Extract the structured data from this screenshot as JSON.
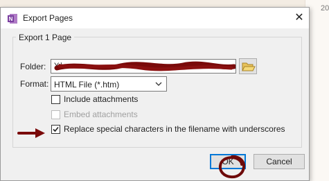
{
  "background": {
    "partial_date": "20"
  },
  "dialog": {
    "title": "Export Pages",
    "close_glyph": "✕",
    "group_title": "Export 1 Page",
    "folder": {
      "label": "Folder:",
      "value": "Y:\\"
    },
    "format": {
      "label": "Format:",
      "selected": "HTML File (*.htm)"
    },
    "options": [
      {
        "label": "Include attachments",
        "checked": false,
        "enabled": true
      },
      {
        "label": "Embed attachments",
        "checked": false,
        "enabled": false
      },
      {
        "label": "Replace special characters in the filename with underscores",
        "checked": true,
        "enabled": true
      }
    ],
    "ok_label": "OK",
    "cancel_label": "Cancel"
  },
  "colors": {
    "onenote_purple": "#7b3fa0",
    "annotation_red": "#7a0a0a",
    "default_button_border": "#0078d7"
  },
  "icons": {
    "app": "onenote-icon",
    "close": "close-icon",
    "browse": "folder-icon",
    "dropdown": "chevron-down-icon"
  }
}
